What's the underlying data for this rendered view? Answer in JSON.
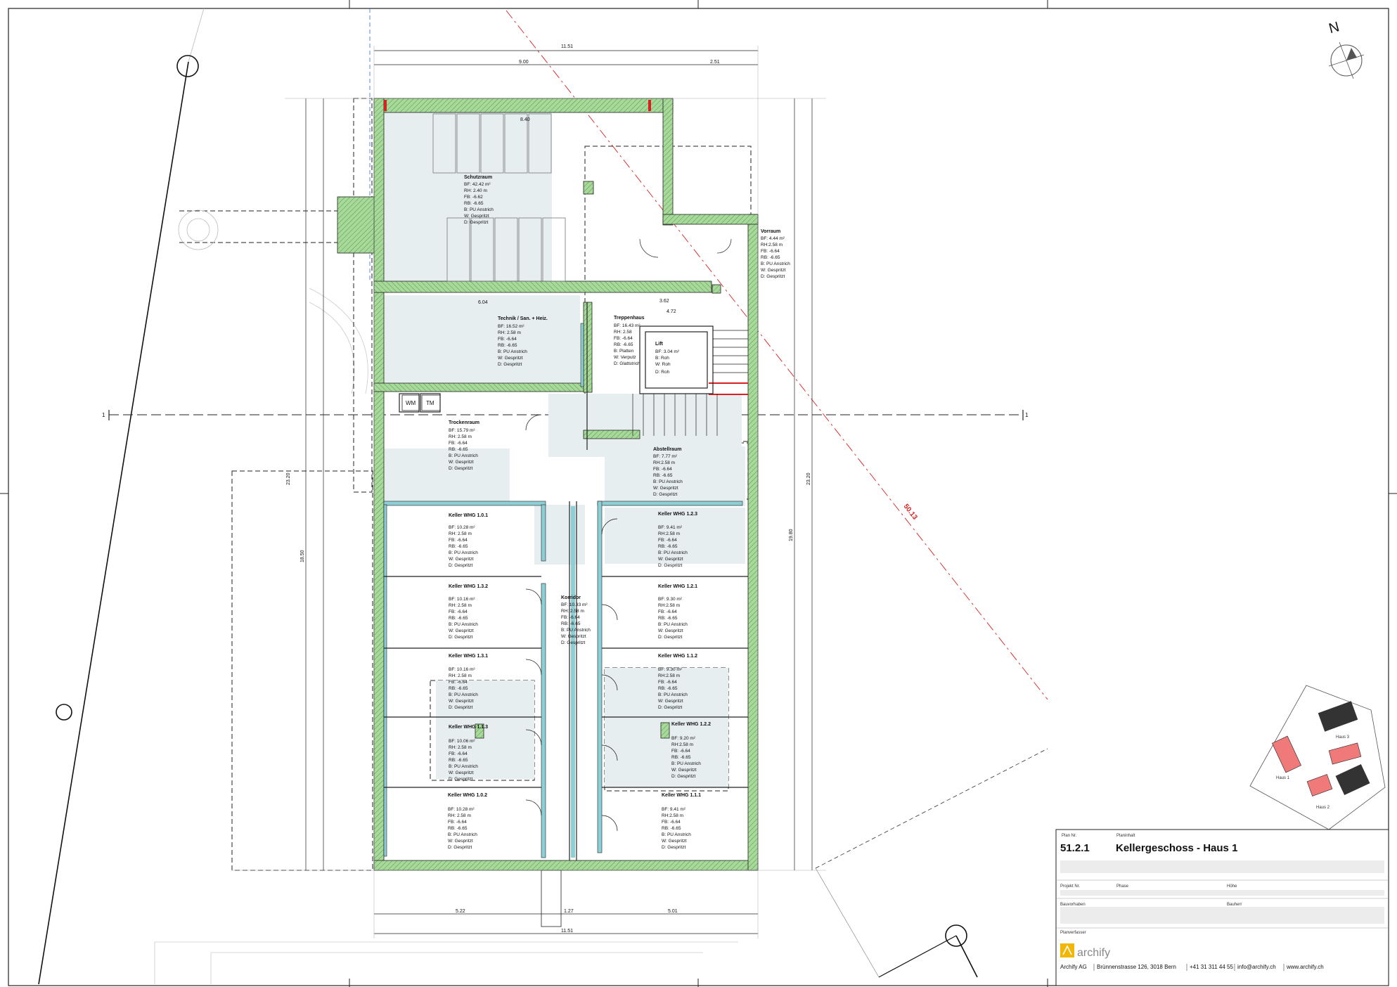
{
  "north_label": "N",
  "section_marker": "1",
  "dimensions": {
    "top_overall": "11.51",
    "top_left": "9.00",
    "top_right": "2.51",
    "bottom_overall": "11.51",
    "bottom_left": "5.22",
    "bottom_mid": "1.27",
    "bottom_right": "5.01",
    "left_total": "23.20",
    "left_lower": "18.50",
    "right_total": "23.20",
    "right_lower": "19.80",
    "top_inner": "8.40",
    "diag": "50.13",
    "stair_w": "3.62",
    "stair_total": "4.72",
    "tech_w": "6.04"
  },
  "rooms": [
    {
      "title": "Schutzraum",
      "lines": [
        "BF: 42.42 m²",
        "RH: 2.40 m",
        "FB: -6.62",
        "RB: -6.65",
        "B: PU Anstrich",
        "W: Gespritzt",
        "D: Gespritzt"
      ]
    },
    {
      "title": "Vorraum",
      "lines": [
        "BF: 4.44 m²",
        "RH:2.58 m",
        "FB: -6.64",
        "RB: -6.65",
        "B: PU Anstrich",
        "W: Gespritzt",
        "D: Gespritzt"
      ]
    },
    {
      "title": "Technik / San. + Heiz.",
      "lines": [
        "BF: 16.52 m²",
        "RH: 2.58 m",
        "FB: -6.64",
        "RB: -6.65",
        "B: PU Anstrich",
        "W: Gespritzt",
        "D: Gespritzt"
      ]
    },
    {
      "title": "Treppenhaus",
      "lines": [
        "BF: 16.43 m²",
        "RH: 2.58",
        "FB: -6.64",
        "RB: -6.65",
        "B: Platten",
        "W: Verputz",
        "D: Glattstrich"
      ]
    },
    {
      "title": "Lift",
      "lines": [
        "BF: 3.04 m²",
        "B: Roh",
        "W: Roh",
        "D: Roh"
      ]
    },
    {
      "title": "Trockenraum",
      "lines": [
        "BF: 15.79 m²",
        "RH: 2.58 m",
        "FB: -6.64",
        "RB: -6.65",
        "B: PU Anstrich",
        "W: Gespritzt",
        "D: Gespritzt"
      ]
    },
    {
      "title": "Abstellraum",
      "lines": [
        "BF: 7.77 m²",
        "RH:2.58 m",
        "FB: -6.64",
        "RB: -6.65",
        "B: PU Anstrich",
        "W: Gespritzt",
        "D: Gespritzt"
      ]
    },
    {
      "title": "Keller WHG 1.0.1",
      "lines": [
        "BF: 10.28 m²",
        "RH: 2.58 m",
        "FB: -6.64",
        "RB: -6.65",
        "B: PU Anstrich",
        "W: Gespritzt",
        "D: Gespritzt"
      ]
    },
    {
      "title": "Keller WHG 1.2.3",
      "lines": [
        "BF: 9.41 m²",
        "RH:2.58 m",
        "FB: -6.64",
        "RB: -6.65",
        "B: PU Anstrich",
        "W: Gespritzt",
        "D: Gespritzt"
      ]
    },
    {
      "title": "Keller WHG 1.3.2",
      "lines": [
        "BF: 10.16 m²",
        "RH: 2.58 m",
        "FB: -6.64",
        "RB: -6.65",
        "B: PU Anstrich",
        "W: Gespritzt",
        "D: Gespritzt"
      ]
    },
    {
      "title": "Korridor",
      "lines": [
        "BF: 10.33 m²",
        "RH: 2.58 m",
        "FB: -6.64",
        "RB: -6.65",
        "B: PU Anstrich",
        "W: Gespritzt",
        "D: Gespritzt"
      ]
    },
    {
      "title": "Keller WHG 1.2.1",
      "lines": [
        "BF: 9.30 m²",
        "RH:2.58 m",
        "FB: -6.64",
        "RB: -6.65",
        "B: PU Anstrich",
        "W: Gespritzt",
        "D: Gespritzt"
      ]
    },
    {
      "title": "Keller WHG 1.3.1",
      "lines": [
        "BF: 10.16 m²",
        "RH: 2.58 m",
        "FB: -6.64",
        "RB: -6.65",
        "B: PU Anstrich",
        "W: Gespritzt",
        "D: Gespritzt"
      ]
    },
    {
      "title": "Keller WHG 1.1.2",
      "lines": [
        "BF: 9.30 m²",
        "RH:2.58 m",
        "FB: -6.64",
        "RB: -6.65",
        "B: PU Anstrich",
        "W: Gespritzt",
        "D: Gespritzt"
      ]
    },
    {
      "title": "Keller WHG 1.1.3",
      "lines": [
        "BF: 10.06 m²",
        "RH: 2.58 m",
        "FB: -6.64",
        "RB: -6.65",
        "B: PU Anstrich",
        "W: Gespritzt",
        "D: Gespritzt"
      ]
    },
    {
      "title": "Keller WHG 1.2.2",
      "lines": [
        "BF: 9.20 m²",
        "RH:2.58 m",
        "FB: -6.64",
        "RB: -6.65",
        "B: PU Anstrich",
        "W: Gespritzt",
        "D: Gespritzt"
      ]
    },
    {
      "title": "Keller WHG 1.0.2",
      "lines": [
        "BF: 10.28 m²",
        "RH: 2.58 m",
        "FB: -6.64",
        "RB: -6.65",
        "B: PU Anstrich",
        "W: Gespritzt",
        "D: Gespritzt"
      ]
    },
    {
      "title": "Keller WHG 1.1.1",
      "lines": [
        "BF: 9.41 m²",
        "RH:2.58 m",
        "FB: -6.64",
        "RB: -6.65",
        "B: PU Anstrich",
        "W: Gespritzt",
        "D: Gespritzt"
      ]
    }
  ],
  "fixtures": {
    "washer": "WM",
    "dryer": "TM"
  },
  "site_plan": {
    "house1": "Haus 1",
    "house2": "Haus 2",
    "house3": "Haus 3"
  },
  "title_block": {
    "plan_nr_label": "Plan Nr.",
    "plan_name_label": "Planinhalt",
    "plan_nr": "51.2.1",
    "plan_title": "Kellergeschoss - Haus 1",
    "project_nr_label": "Projekt Nr.",
    "phase_label": "Phase",
    "scale_label": "Höhe",
    "client_label": "Bauvorhaben",
    "owner_label": "Bauherr",
    "author_label": "Planverfasser",
    "brand": "archify",
    "company": "Archify AG",
    "address": "Brünnenstrasse 126, 3018 Bern",
    "phone": "+41 31 311 44 55",
    "email": "info@archify.ch",
    "web": "www.archify.ch"
  },
  "colors": {
    "wall": "#a8d89a",
    "wall_hatch": "#4c9a4c",
    "glass": "#8ecfd6",
    "room_fill": "#e6eef0",
    "red": "#d82020",
    "blue": "#2a6fd6",
    "house_red": "#f07a7a",
    "house_dark": "#333333"
  }
}
